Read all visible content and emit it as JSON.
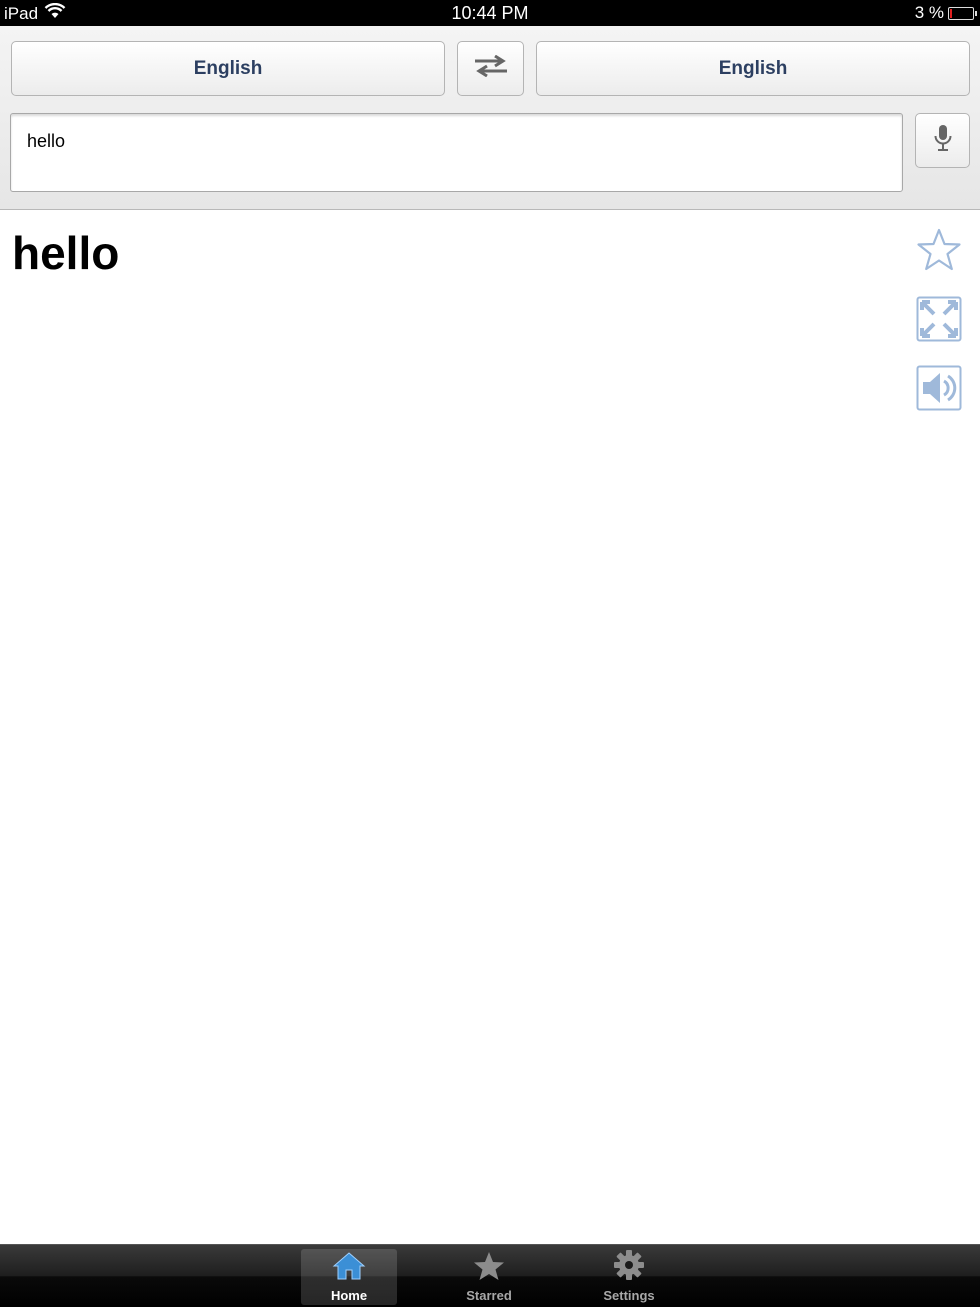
{
  "status_bar": {
    "device": "iPad",
    "time": "10:44 PM",
    "battery": "3 %",
    "battery_level": 0.03
  },
  "header": {
    "source_language": "English",
    "target_language": "English",
    "input_value": "hello"
  },
  "result": {
    "text": "hello"
  },
  "tabs": [
    {
      "label": "Home",
      "active": true
    },
    {
      "label": "Starred",
      "active": false
    },
    {
      "label": "Settings",
      "active": false
    }
  ],
  "colors": {
    "accent_blue": "#3b8fd6",
    "icon_light_blue": "#9fb9da",
    "language_text": "#2c3f61"
  }
}
